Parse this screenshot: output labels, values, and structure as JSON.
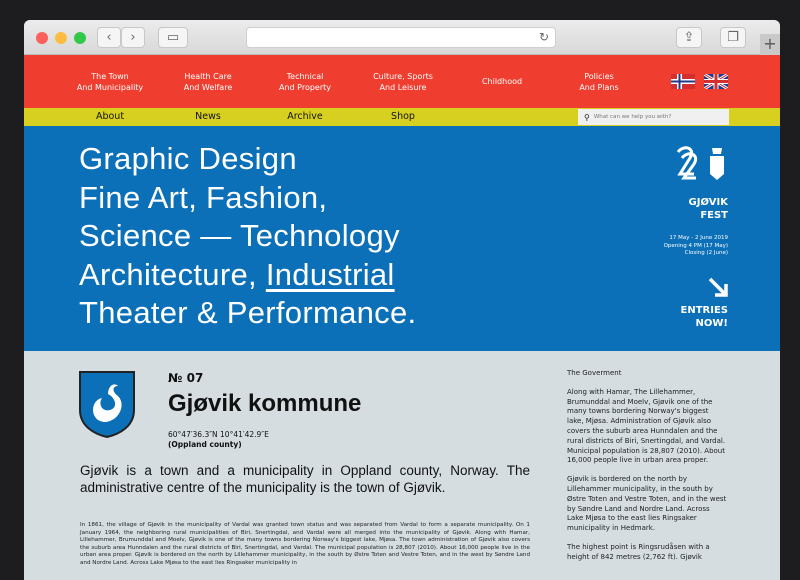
{
  "nav_primary": [
    "The Town\nAnd Municipality",
    "Health Care\nAnd Welfare",
    "Technical\nAnd Property",
    "Culture, Sports\nAnd Leisure",
    "Childhood",
    "Policies\nAnd Plans"
  ],
  "nav_secondary": [
    "About",
    "News",
    "Archive",
    "Shop"
  ],
  "search": {
    "placeholder": "What can we help you with?"
  },
  "hero": {
    "line1": "Graphic Design",
    "line2": "Fine Art, Fashion,",
    "line3": "Science — Technology",
    "line4a": "Architecture, ",
    "line4b": "Industrial",
    "line5": "Theater & Performance."
  },
  "fest": {
    "title1": "GJØVIK",
    "title2": "FEST",
    "date1": "17 May - 2 June 2019",
    "date2": "Opening 4 PM (17 May)",
    "date3": "Closing (2 June)",
    "cta1": "ENTRIES",
    "cta2": "NOW!"
  },
  "article": {
    "number": "№ 07",
    "title": "Gjøvik kommune",
    "coords": "60°47′36.3″N 10°41′42.9″E",
    "county": "(Oppland county)",
    "lead": "Gjøvik is a town and a municipality in Oppland county, Norway. The administrative centre of the municipality is the town of Gjøvik.",
    "body": "In 1861, the village of Gjøvik in the municipality of Vardal was granted town status and was separated from Vardal to form a separate municipality. On 1 January 1964, the neighboring rural municipalities of Biri, Snertingdal, and Vardal were all merged into the municipality of Gjøvik. Along with Hamar, Lillehammer, Brumunddal and Moelv, Gjøvik is one of the many towns bordering Norway's biggest lake, Mjøsa. The town administration of Gjøvik also covers the suburb area Hunndalen and the rural districts of Biri, Snertingdal, and Vardal. The municipal population is 28,807 (2010). About 16,000 people live in the urban area proper. Gjøvik is bordered on the north by Lillehammer municipality, in the south by Østre Toten and Vestre Toten, and in the west by Søndre Land and Nordre Land. Across Lake Mjøsa to the east lies Ringsaker municipality in"
  },
  "sidebar": {
    "heading": "The Goverment",
    "p1": "Along with Hamar, The Lillehammer, Brumunddal and Moelv, Gjøvik one of the many towns bordering Norway's biggest lake, Mjøsa. Administration of Gjøvik also covers the suburb area Hunndalen and the rural districts of Biri, Snertingdal, and Vardal. Municipal population is 28,807 (2010). About 16,000 people live in urban area proper.",
    "p2": "Gjøvik is bordered on the north by Lillehammer municipality, in the south by Østre Toten and Vestre Toten, and in the west by Søndre Land and Nordre Land. Across Lake Mjøsa to the east lies Ringsaker municipality in Hedmark.",
    "p3": "The highest point is Ringsrudåsen with a height of 842 metres (2,762 ft). Gjøvik"
  },
  "colors": {
    "red": "#ef3e2f",
    "yellow": "#d8d020",
    "blue": "#0b70b8",
    "gray": "#d5dde1"
  }
}
